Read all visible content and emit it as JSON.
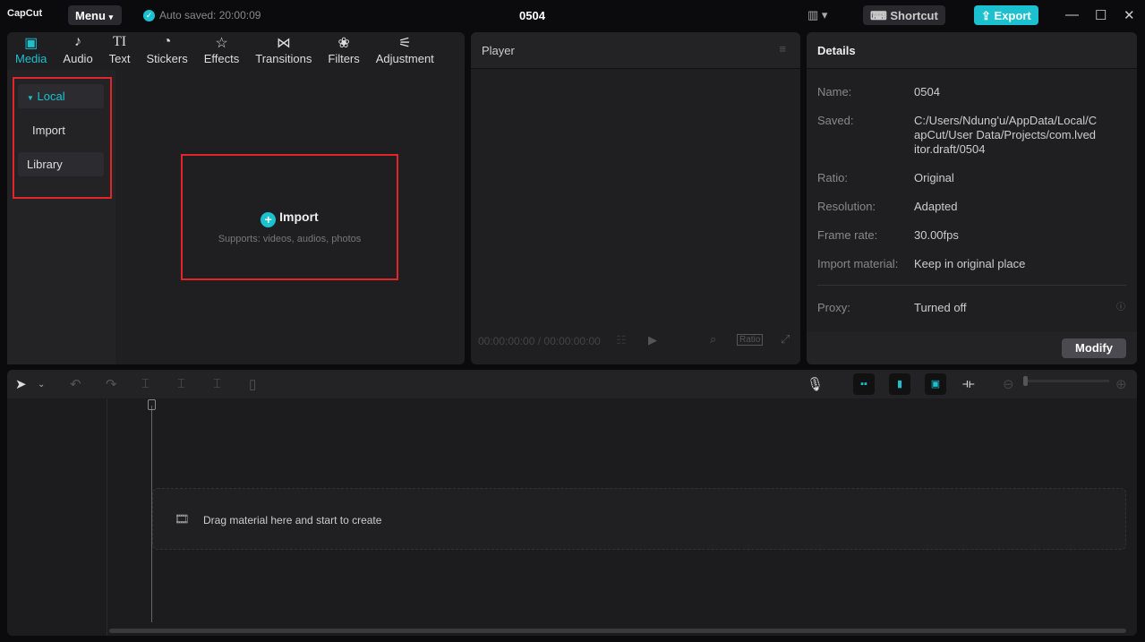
{
  "app": {
    "logo": "CapCut",
    "menu": "Menu",
    "autosave": "Auto saved: 20:00:09",
    "project_title": "0504",
    "shortcut": "Shortcut",
    "export": "Export"
  },
  "tabs": [
    {
      "label": "Media",
      "icon": "media-icon",
      "active": true
    },
    {
      "label": "Audio",
      "icon": "audio-icon"
    },
    {
      "label": "Text",
      "icon": "text-icon"
    },
    {
      "label": "Stickers",
      "icon": "sticker-icon"
    },
    {
      "label": "Effects",
      "icon": "effects-icon"
    },
    {
      "label": "Transitions",
      "icon": "transitions-icon"
    },
    {
      "label": "Filters",
      "icon": "filters-icon"
    },
    {
      "label": "Adjustment",
      "icon": "adjustment-icon"
    }
  ],
  "sidebar": {
    "local": "Local",
    "import": "Import",
    "library": "Library"
  },
  "import_area": {
    "label": "Import",
    "hint": "Supports: videos, audios, photos"
  },
  "player": {
    "title": "Player",
    "timecode": "00:00:00:00 / 00:00:00:00",
    "ratio": "Ratio"
  },
  "details": {
    "title": "Details",
    "rows": [
      {
        "k": "Name:",
        "v": "0504"
      },
      {
        "k": "Saved:",
        "v": "C:/Users/Ndung'u/AppData/Local/CapCut/User Data/Projects/com.lveditor.draft/0504"
      },
      {
        "k": "Ratio:",
        "v": "Original"
      },
      {
        "k": "Resolution:",
        "v": "Adapted"
      },
      {
        "k": "Frame rate:",
        "v": "30.00fps"
      },
      {
        "k": "Import material:",
        "v": "Keep in original place"
      }
    ],
    "proxy_label": "Proxy:",
    "proxy_value": "Turned off",
    "modify": "Modify"
  },
  "timeline": {
    "drop_hint": "Drag material here and start to create"
  },
  "colors": {
    "accent": "#1cc1d0",
    "highlight": "#e0252b"
  }
}
